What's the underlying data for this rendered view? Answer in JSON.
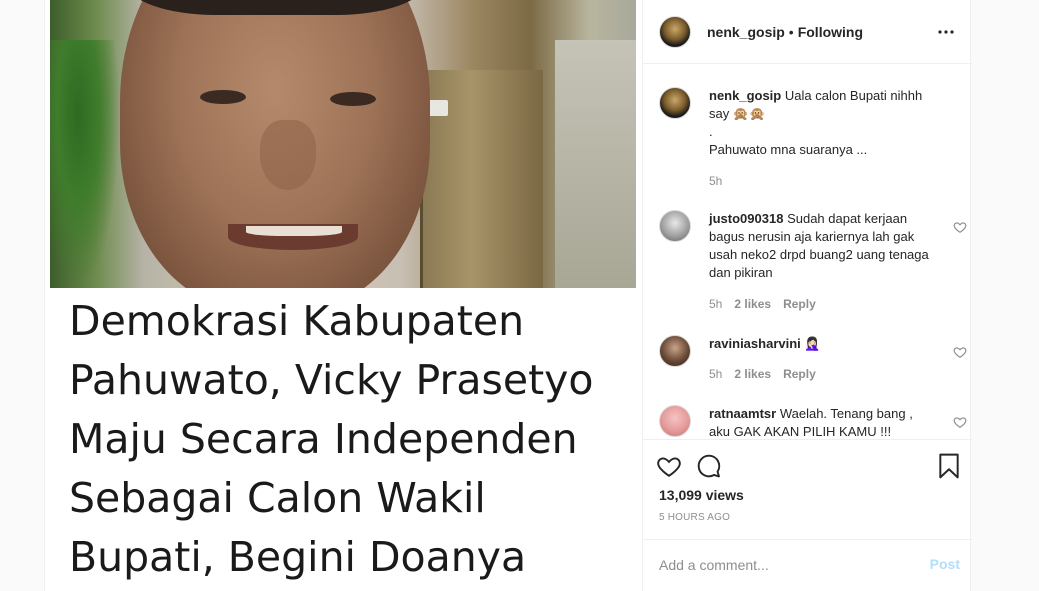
{
  "header": {
    "username": "nenk_gosip",
    "separator": "•",
    "follow_status": "Following"
  },
  "media": {
    "headline_lines": [
      "Demokrasi Kabupaten",
      "Pahuwato, Vicky Prasetyo",
      "Maju Secara Independen",
      "Sebagai Calon Wakil",
      "Bupati, Begini Doanya"
    ]
  },
  "caption": {
    "username": "nenk_gosip",
    "text_line1": "Uala calon Bupati nihhh say 🙊🙊",
    "text_line2": ".",
    "text_line3": "Pahuwato mna suaranya ...",
    "time": "5h"
  },
  "comments": [
    {
      "username": "justo090318",
      "text": "Sudah dapat kerjaan bagus nerusin aja kariernya lah gak usah neko2 drpd buang2 uang tenaga dan pikiran",
      "time": "5h",
      "likes": "2 likes",
      "reply": "Reply"
    },
    {
      "username": "raviniasharvini",
      "text": "🤦🏻‍♀️",
      "time": "5h",
      "likes": "2 likes",
      "reply": "Reply"
    },
    {
      "username": "ratnaamtsr",
      "text": "Waelah. Tenang bang , aku GAK AKAN PILIH KAMU !!!"
    }
  ],
  "stats": {
    "views": "13,099 views",
    "time_ago": "5 HOURS AGO"
  },
  "add_comment": {
    "placeholder": "Add a comment...",
    "post_label": "Post"
  },
  "colors": {
    "text": "#262626",
    "muted": "#8e8e8e",
    "border": "#efefef",
    "post_disabled": "#b2dffc"
  },
  "icons": {
    "more": "more-icon",
    "like": "heart-icon",
    "comment": "comment-icon",
    "save": "bookmark-icon"
  }
}
